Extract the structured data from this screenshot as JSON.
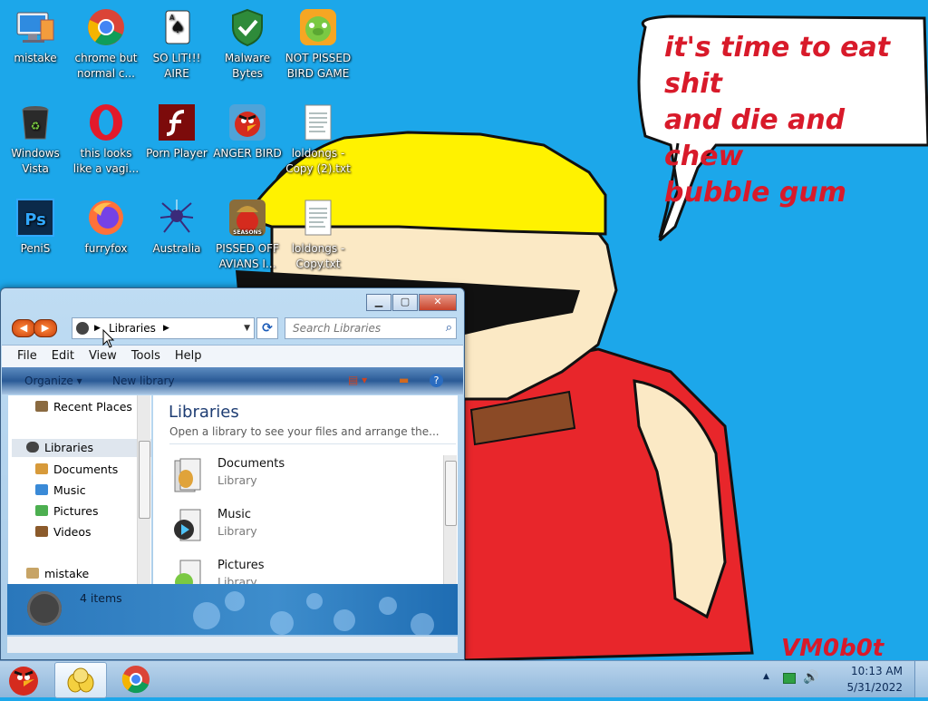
{
  "wallpaper": {
    "speech": "it's time to eat shit\nand die and chew\nbubble gum",
    "signature": "VM0b0t"
  },
  "desktop_icons": [
    {
      "label": "mistake",
      "icon": "computer-icon"
    },
    {
      "label": "chrome but normal c...",
      "icon": "chrome-icon"
    },
    {
      "label": "SO LIT!!! AIRE",
      "icon": "solitaire-icon"
    },
    {
      "label": "Malware Bytes",
      "icon": "shield-check-icon"
    },
    {
      "label": "NOT PISSED BIRD GAME",
      "icon": "green-pig-icon"
    },
    {
      "label": "Windows Vista",
      "icon": "recycle-bin-icon"
    },
    {
      "label": "this looks like a vagi...",
      "icon": "opera-icon"
    },
    {
      "label": "Porn Player",
      "icon": "flash-player-icon"
    },
    {
      "label": "ANGER BIRD",
      "icon": "red-bird-icon"
    },
    {
      "label": "loldongs - Copy (2).txt",
      "icon": "text-file-icon"
    },
    {
      "label": "PeniS",
      "icon": "photoshop-icon"
    },
    {
      "label": "furryfox",
      "icon": "firefox-icon"
    },
    {
      "label": "Australia",
      "icon": "spider-solitaire-icon"
    },
    {
      "label": "PISSED OFF AVIANS I...",
      "icon": "angry-birds-seasons-icon"
    },
    {
      "label": "loldongs - Copy.txt",
      "icon": "text-file-icon"
    }
  ],
  "explorer": {
    "address": "Libraries",
    "search_placeholder": "Search Libraries",
    "menu": [
      "File",
      "Edit",
      "View",
      "Tools",
      "Help"
    ],
    "commands": {
      "organize": "Organize",
      "new_library": "New library"
    },
    "nav": {
      "recent": "Recent Places",
      "libraries": "Libraries",
      "documents": "Documents",
      "music": "Music",
      "pictures": "Pictures",
      "videos": "Videos",
      "computer": "mistake"
    },
    "content_title": "Libraries",
    "content_subtitle": "Open a library to see your files and arrange the...",
    "items": [
      {
        "name": "Documents",
        "type": "Library"
      },
      {
        "name": "Music",
        "type": "Library"
      },
      {
        "name": "Pictures",
        "type": "Library"
      }
    ],
    "details_count": "4 items"
  },
  "tray": {
    "time": "10:13 AM",
    "date": "5/31/2022"
  },
  "colors": {
    "wallpaper": "#1ca7ea",
    "speech_text": "#d81a2a",
    "hat": "#fff200",
    "shirt": "#e8262b"
  }
}
